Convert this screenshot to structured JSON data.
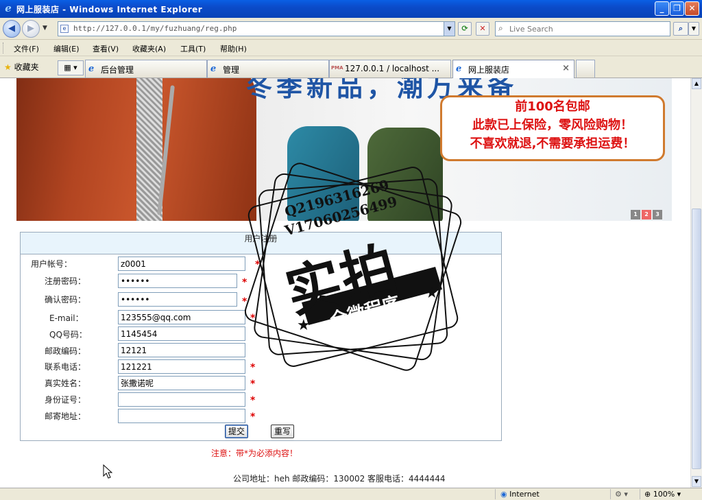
{
  "window": {
    "title": "网上服装店 - Windows Internet Explorer",
    "minimize": "_",
    "restore": "❐",
    "close": "✕"
  },
  "address": {
    "url": "http://127.0.0.1/my/fuzhuang/reg.php",
    "search_placeholder": "Live Search"
  },
  "menu": [
    "文件(F)",
    "编辑(E)",
    "查看(V)",
    "收藏夹(A)",
    "工具(T)",
    "帮助(H)"
  ],
  "tabs": {
    "favorites": "收藏夹",
    "items": [
      {
        "label": "后台管理"
      },
      {
        "label": "管理"
      },
      {
        "label": "127.0.0.1 / localhost ..."
      },
      {
        "label": "网上服装店"
      }
    ]
  },
  "banner": {
    "headline": "冬季新品，潮万来备",
    "promo": [
      "前100名包邮",
      "此款已上保险，零风险购物！",
      "不喜欢就退,不需要承担运费！"
    ],
    "pages": [
      "1",
      "2",
      "3"
    ]
  },
  "watermark": {
    "line1": "Q2196316269",
    "line2": "V17060256499",
    "big": "实拍",
    "sub": "全微程序"
  },
  "form": {
    "title": "用户注册",
    "required_mark": "*",
    "fields": [
      {
        "label": "用户帐号：",
        "value": "z0001"
      },
      {
        "label": "注册密码：",
        "value": "••••••"
      },
      {
        "label": "确认密码：",
        "value": "••••••"
      },
      {
        "label": "E-mail：",
        "value": "123555@qq.com"
      },
      {
        "label": "QQ号码：",
        "value": "1145454"
      },
      {
        "label": "邮政编码：",
        "value": "12121"
      },
      {
        "label": "联系电话：",
        "value": "121221"
      },
      {
        "label": "真实姓名：",
        "value": "张撒诺呢"
      },
      {
        "label": "身份证号：",
        "value": ""
      },
      {
        "label": "邮寄地址：",
        "value": ""
      }
    ],
    "submit": "提交",
    "reset": "重写",
    "notice": "注意：带*为必添内容！"
  },
  "footer": {
    "text": "公司地址：heh   邮政编码：130002  客服电话：4444444"
  },
  "status": {
    "zone": "Internet",
    "zoom": "100%"
  }
}
